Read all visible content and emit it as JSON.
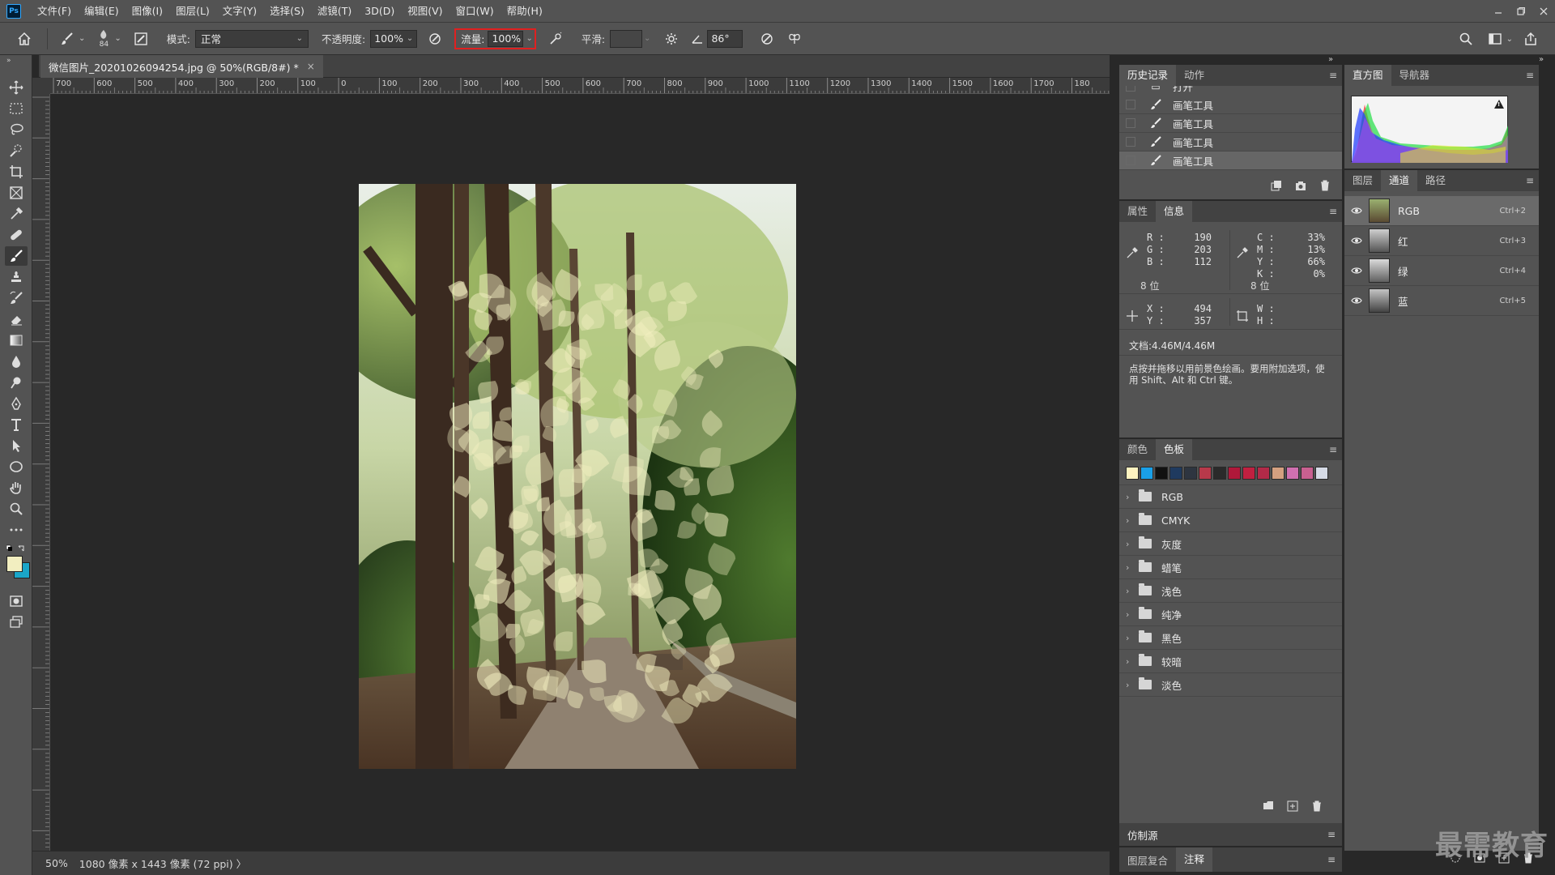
{
  "app": {
    "logo": "Ps"
  },
  "menu": [
    "文件(F)",
    "编辑(E)",
    "图像(I)",
    "图层(L)",
    "文字(Y)",
    "选择(S)",
    "滤镜(T)",
    "3D(D)",
    "视图(V)",
    "窗口(W)",
    "帮助(H)"
  ],
  "options": {
    "brush_size": "84",
    "mode_label": "模式:",
    "mode_value": "正常",
    "opacity_label": "不透明度:",
    "opacity_value": "100%",
    "flow_label": "流量:",
    "flow_value": "100%",
    "smooth_label": "平滑:",
    "angle_value": "86°"
  },
  "document": {
    "tab_title": "微信图片_20201026094254.jpg @ 50%(RGB/8#) *",
    "close": "×"
  },
  "ruler": {
    "top_labels": [
      "700",
      "600",
      "500",
      "400",
      "300",
      "200",
      "100",
      "0",
      "100",
      "200",
      "300",
      "400",
      "500",
      "600",
      "700",
      "800",
      "900",
      "1000",
      "1100",
      "1200",
      "1300",
      "1400",
      "1500",
      "1600",
      "1700",
      "180"
    ]
  },
  "status": {
    "zoom": "50%",
    "doc_size": "1080 像素 x 1443 像素 (72 ppi)",
    "arrow": "〉"
  },
  "history_panel": {
    "tabs": [
      "历史记录",
      "动作"
    ],
    "rows": [
      "打开",
      "画笔工具",
      "画笔工具",
      "画笔工具",
      "画笔工具"
    ]
  },
  "info_panel": {
    "tabs": [
      "属性",
      "信息"
    ],
    "rgb": {
      "r_label": "R :",
      "g_label": "G :",
      "b_label": "B :",
      "r": "190",
      "g": "203",
      "b": "112",
      "bits": "8 位"
    },
    "cmyk": {
      "c_label": "C :",
      "m_label": "M :",
      "y_label": "Y :",
      "k_label": "K :",
      "c": "33%",
      "m": "13%",
      "y": "66%",
      "k": "0%",
      "bits": "8 位"
    },
    "xy": {
      "x_label": "X :",
      "y_label": "Y :",
      "x": "494",
      "y": "357"
    },
    "wh": {
      "w_label": "W :",
      "h_label": "H :"
    },
    "doc": "文档:4.46M/4.46M",
    "hint": "点按并拖移以用前景色绘画。要用附加选项，使用 Shift、Alt 和 Ctrl 键。"
  },
  "swatch_panel": {
    "tabs": [
      "颜色",
      "色板"
    ],
    "colors": [
      "#fff3c0",
      "#1aa0e8",
      "#111111",
      "#1f3a5f",
      "#2e3540",
      "#b8394a",
      "#2a2a2a",
      "#b0183a",
      "#c02040",
      "#b32a48",
      "#d4a080",
      "#d070b0",
      "#c86090",
      "#d6dbe6"
    ],
    "groups": [
      "RGB",
      "CMYK",
      "灰度",
      "蜡笔",
      "浅色",
      "纯净",
      "黑色",
      "较暗",
      "淡色"
    ]
  },
  "clone_panel": {
    "title": "仿制源"
  },
  "bottom_tabs": [
    "图层复合",
    "注释"
  ],
  "histogram_panel": {
    "tabs": [
      "直方图",
      "导航器"
    ],
    "warning": "!"
  },
  "channels_panel": {
    "tabs": [
      "图层",
      "通道",
      "路径"
    ],
    "rows": [
      {
        "name": "RGB",
        "key": "Ctrl+2"
      },
      {
        "name": "红",
        "key": "Ctrl+3"
      },
      {
        "name": "绿",
        "key": "Ctrl+4"
      },
      {
        "name": "蓝",
        "key": "Ctrl+5"
      }
    ]
  },
  "watermark": "最需教育",
  "colors": {
    "foreground": "#f2eec0",
    "background": "#1aa6c8",
    "highlight": "#e02020"
  }
}
